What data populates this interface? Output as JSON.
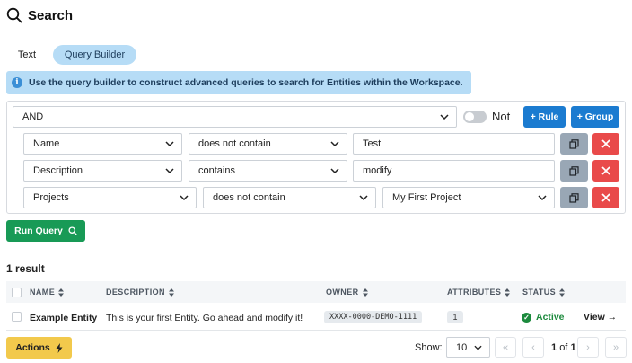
{
  "header": {
    "title": "Search"
  },
  "tabs": [
    {
      "label": "Text",
      "active": false
    },
    {
      "label": "Query Builder",
      "active": true
    }
  ],
  "info_banner": {
    "text": "Use the query builder to construct advanced queries to search for Entities within the Workspace."
  },
  "query": {
    "combinator": "AND",
    "not_label": "Not",
    "add_rule_label": "+ Rule",
    "add_group_label": "+ Group",
    "rules": [
      {
        "field": "Name",
        "operator": "does not contain",
        "value": "Test"
      },
      {
        "field": "Description",
        "operator": "contains",
        "value": "modify"
      },
      {
        "field": "Projects",
        "operator": "does not contain",
        "value": "My First Project"
      }
    ],
    "run_label": "Run Query"
  },
  "results": {
    "count_label": "1 result",
    "columns": [
      "NAME",
      "DESCRIPTION",
      "OWNER",
      "ATTRIBUTES",
      "STATUS"
    ],
    "rows": [
      {
        "name": "Example Entity",
        "description": "This is your first Entity. Go ahead and modify it!",
        "owner": "XXXX-0000-DEMO-1111",
        "attributes": "1",
        "status": "Active",
        "action": "View →"
      }
    ]
  },
  "footer": {
    "actions_label": "Actions",
    "show_label": "Show:",
    "page_size": "10",
    "page_current": "1",
    "page_of": "of",
    "page_total": "1"
  },
  "colors": {
    "primary": "#1b7bd0",
    "success": "#189a56",
    "danger": "#e94a4a",
    "warning": "#f2c94c",
    "info_bg": "#b6dcf6"
  }
}
